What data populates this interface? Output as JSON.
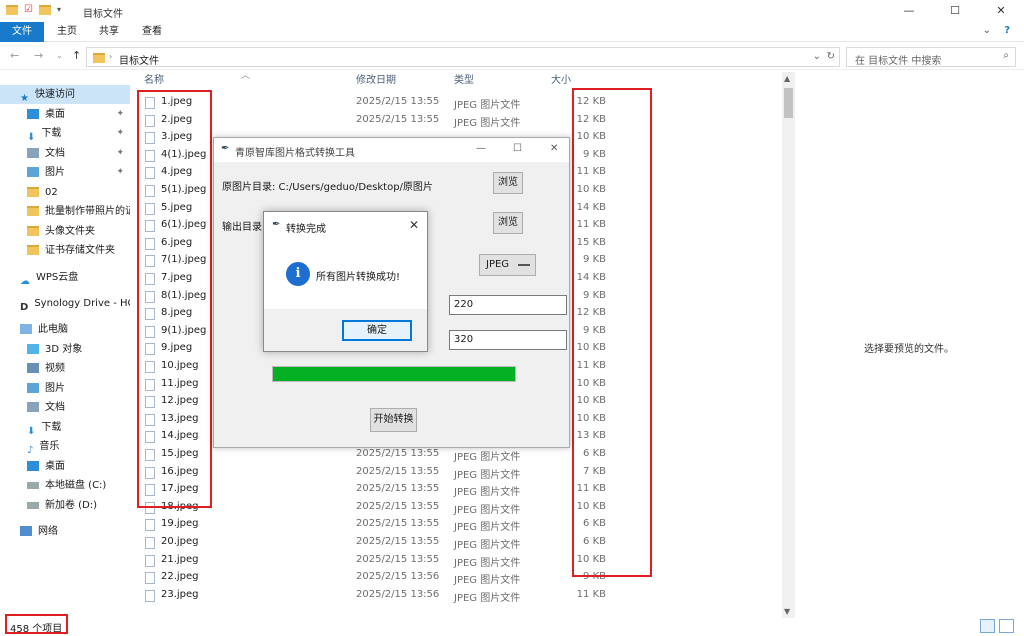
{
  "window": {
    "title": "目标文件",
    "min": "—",
    "max": "☐",
    "close": "✕"
  },
  "ribbon": {
    "tabs": [
      "文件",
      "主页",
      "共享",
      "查看"
    ],
    "expand": "⌄",
    "help": "?"
  },
  "address": {
    "path": "目标文件",
    "search_placeholder": "在 目标文件 中搜索"
  },
  "sidebar": [
    {
      "label": "快速访问",
      "icon": "star-icon",
      "pin": ""
    },
    {
      "label": "桌面",
      "icon": "desktop-icon",
      "pin": "📌"
    },
    {
      "label": "下载",
      "icon": "download-icon",
      "pin": "📌"
    },
    {
      "label": "文档",
      "icon": "document-icon",
      "pin": "📌"
    },
    {
      "label": "图片",
      "icon": "picture-icon",
      "pin": "📌"
    },
    {
      "label": "02",
      "icon": "folder-icon",
      "pin": ""
    },
    {
      "label": "批量制作带照片的证",
      "icon": "folder-icon",
      "pin": ""
    },
    {
      "label": "头像文件夹",
      "icon": "folder-icon",
      "pin": ""
    },
    {
      "label": "证书存储文件夹",
      "icon": "folder-icon",
      "pin": ""
    },
    {
      "label": "WPS云盘",
      "icon": "cloud-icon",
      "pin": ""
    },
    {
      "label": "Synology Drive - HC",
      "icon": "synology-icon",
      "pin": ""
    },
    {
      "label": "此电脑",
      "icon": "computer-icon",
      "pin": ""
    },
    {
      "label": "3D 对象",
      "icon": "3d-objects-icon",
      "pin": ""
    },
    {
      "label": "视频",
      "icon": "video-icon",
      "pin": ""
    },
    {
      "label": "图片",
      "icon": "picture-icon",
      "pin": ""
    },
    {
      "label": "文档",
      "icon": "document-icon",
      "pin": ""
    },
    {
      "label": "下载",
      "icon": "download-icon",
      "pin": ""
    },
    {
      "label": "音乐",
      "icon": "music-icon",
      "pin": ""
    },
    {
      "label": "桌面",
      "icon": "desktop-icon",
      "pin": ""
    },
    {
      "label": "本地磁盘 (C:)",
      "icon": "drive-icon",
      "pin": ""
    },
    {
      "label": "新加卷 (D:)",
      "icon": "drive-icon",
      "pin": ""
    },
    {
      "label": "网络",
      "icon": "network-icon",
      "pin": ""
    }
  ],
  "columns": {
    "name": "名称",
    "date": "修改日期",
    "type": "类型",
    "size": "大小"
  },
  "files": [
    {
      "name": "1.jpeg",
      "date": "2025/2/15 13:55",
      "type": "JPEG 图片文件",
      "size": "12 KB"
    },
    {
      "name": "2.jpeg",
      "date": "2025/2/15 13:55",
      "type": "JPEG 图片文件",
      "size": "12 KB"
    },
    {
      "name": "3.jpeg",
      "date": "",
      "type": "",
      "size": "10 KB"
    },
    {
      "name": "4(1).jpeg",
      "date": "",
      "type": "",
      "size": "9 KB"
    },
    {
      "name": "4.jpeg",
      "date": "",
      "type": "",
      "size": "11 KB"
    },
    {
      "name": "5(1).jpeg",
      "date": "",
      "type": "",
      "size": "10 KB"
    },
    {
      "name": "5.jpeg",
      "date": "",
      "type": "",
      "size": "14 KB"
    },
    {
      "name": "6(1).jpeg",
      "date": "",
      "type": "",
      "size": "11 KB"
    },
    {
      "name": "6.jpeg",
      "date": "",
      "type": "",
      "size": "15 KB"
    },
    {
      "name": "7(1).jpeg",
      "date": "",
      "type": "",
      "size": "9 KB"
    },
    {
      "name": "7.jpeg",
      "date": "",
      "type": "",
      "size": "14 KB"
    },
    {
      "name": "8(1).jpeg",
      "date": "",
      "type": "",
      "size": "9 KB"
    },
    {
      "name": "8.jpeg",
      "date": "",
      "type": "",
      "size": "12 KB"
    },
    {
      "name": "9(1).jpeg",
      "date": "",
      "type": "",
      "size": "9 KB"
    },
    {
      "name": "9.jpeg",
      "date": "",
      "type": "",
      "size": "10 KB"
    },
    {
      "name": "10.jpeg",
      "date": "",
      "type": "",
      "size": "11 KB"
    },
    {
      "name": "11.jpeg",
      "date": "",
      "type": "",
      "size": "10 KB"
    },
    {
      "name": "12.jpeg",
      "date": "",
      "type": "",
      "size": "10 KB"
    },
    {
      "name": "13.jpeg",
      "date": "",
      "type": "",
      "size": "10 KB"
    },
    {
      "name": "14.jpeg",
      "date": "",
      "type": "",
      "size": "13 KB"
    },
    {
      "name": "15.jpeg",
      "date": "2025/2/15 13:55",
      "type": "JPEG 图片文件",
      "size": "6 KB"
    },
    {
      "name": "16.jpeg",
      "date": "2025/2/15 13:55",
      "type": "JPEG 图片文件",
      "size": "7 KB"
    },
    {
      "name": "17.jpeg",
      "date": "2025/2/15 13:55",
      "type": "JPEG 图片文件",
      "size": "11 KB"
    },
    {
      "name": "18.jpeg",
      "date": "2025/2/15 13:55",
      "type": "JPEG 图片文件",
      "size": "10 KB"
    },
    {
      "name": "19.jpeg",
      "date": "2025/2/15 13:55",
      "type": "JPEG 图片文件",
      "size": "6 KB"
    },
    {
      "name": "20.jpeg",
      "date": "2025/2/15 13:55",
      "type": "JPEG 图片文件",
      "size": "6 KB"
    },
    {
      "name": "21.jpeg",
      "date": "2025/2/15 13:55",
      "type": "JPEG 图片文件",
      "size": "10 KB"
    },
    {
      "name": "22.jpeg",
      "date": "2025/2/15 13:56",
      "type": "JPEG 图片文件",
      "size": "9 KB"
    },
    {
      "name": "23.jpeg",
      "date": "2025/2/15 13:56",
      "type": "JPEG 图片文件",
      "size": "11 KB"
    }
  ],
  "preview_message": "选择要预览的文件。",
  "status": {
    "count": "458 个项目"
  },
  "app": {
    "title": "青原智库图片格式转换工具",
    "src_label": "原图片目录: C:/Users/geduo/Desktop/原图片",
    "browse1": "浏览",
    "out_label": "输出目录:",
    "browse2": "浏览",
    "format": "JPEG",
    "width_value": "220",
    "height_value": "320",
    "progress": 1.0,
    "start": "开始转换"
  },
  "dialog": {
    "title": "转换完成",
    "message": "所有图片转换成功!",
    "ok": "确定"
  },
  "colors": {
    "accent": "#1979ca",
    "highlight": "#e02020",
    "progress": "#06b025"
  }
}
